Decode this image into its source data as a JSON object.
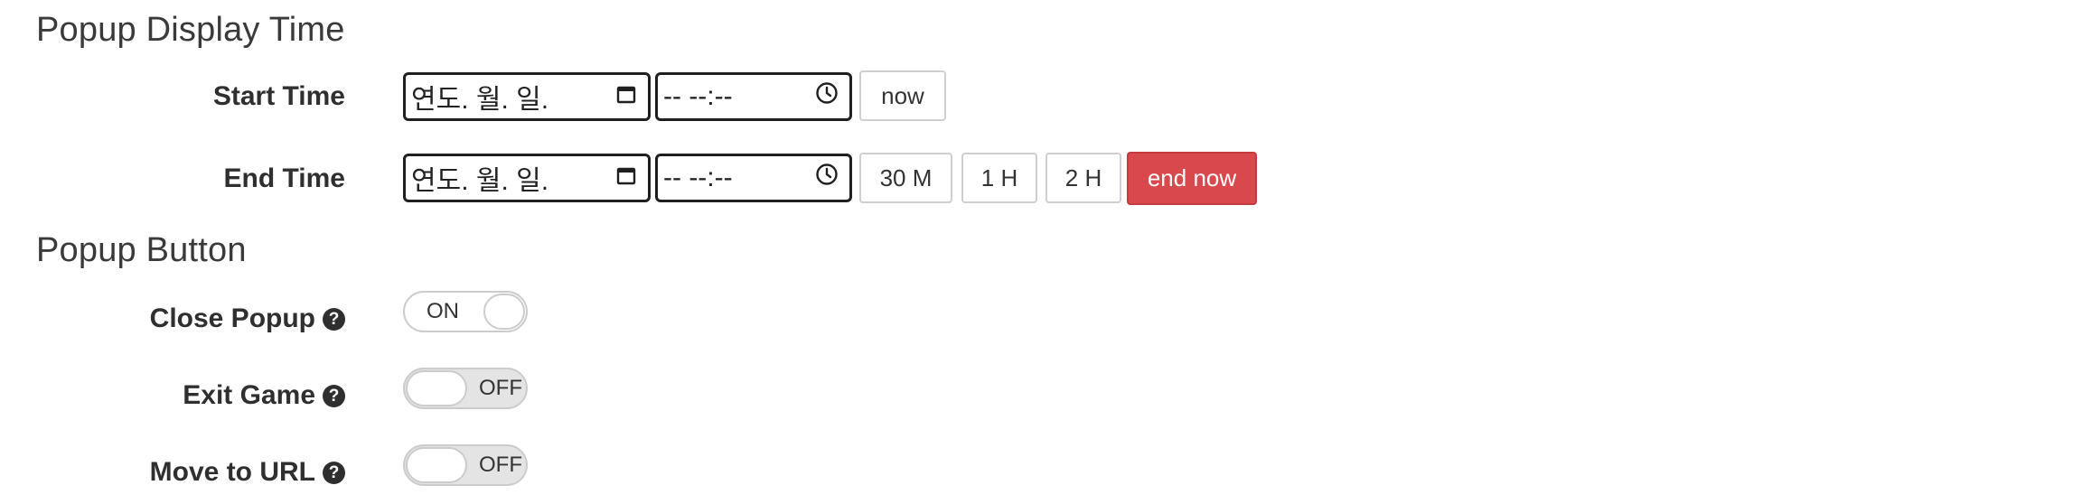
{
  "sections": {
    "display_time_title": "Popup Display Time",
    "button_title": "Popup Button"
  },
  "start_time": {
    "label": "Start Time",
    "date_placeholder": "연도. 월. 일.",
    "time_placeholder": "-- --:--",
    "now_button": "now"
  },
  "end_time": {
    "label": "End Time",
    "date_placeholder": "연도. 월. 일.",
    "time_placeholder": "-- --:--",
    "btn_30m": "30 M",
    "btn_1h": "1 H",
    "btn_2h": "2 H",
    "end_now_button": "end now"
  },
  "popup_buttons": [
    {
      "label": "Close Popup",
      "help_icon": "question-circle-icon",
      "state": "ON"
    },
    {
      "label": "Exit Game",
      "help_icon": "question-circle-icon",
      "state": "OFF"
    },
    {
      "label": "Move to URL",
      "help_icon": "question-circle-icon",
      "state": "OFF"
    }
  ],
  "colors": {
    "danger": "#d9484c",
    "border": "#cccccc",
    "text": "#333333"
  }
}
